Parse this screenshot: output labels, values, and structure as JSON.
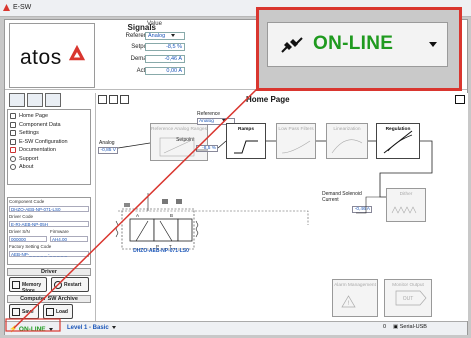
{
  "window": {
    "title": "E-SW"
  },
  "logo": {
    "text": "atos"
  },
  "signals": {
    "title": "Signals",
    "value_header": "Value",
    "rows": [
      {
        "label": "Reference",
        "value": "Analog"
      },
      {
        "label": "Setpoint",
        "value": "-8,5 %"
      },
      {
        "label": "Demand",
        "value": "-0,46 A"
      },
      {
        "label": "Actual",
        "value": "0,00 A"
      }
    ]
  },
  "callout": {
    "label": "ON-LINE",
    "icon": "plug-icon"
  },
  "leftnav": {
    "menu": [
      "Home Page",
      "Component Data",
      "Settings",
      "E-SW Configuration",
      "Documentation",
      "Support",
      "About"
    ]
  },
  "component_info": {
    "component_code_label": "Component Code",
    "component_code": "DHZO-AEB-NP-071-LS0",
    "driver_code_label": "Driver Code",
    "driver_code": "E-RI-AEB-NP-05H",
    "driver_sn_label": "Driver S/N",
    "driver_sn": "000000",
    "firmware_label": "Firmware",
    "firmware": "AH4.00",
    "factory_code_label": "Factory Setting Code",
    "factory_code": "AEB-NP-_ _ _ _ _ -_ _ _ _ _"
  },
  "driver": {
    "title": "Driver",
    "memory_store": "Memory Store",
    "restart": "Restart"
  },
  "archive": {
    "title": "Computer SW Archive",
    "save": "Save",
    "load": "Load"
  },
  "main": {
    "page_title": "Home Page",
    "analog_label": "Analog",
    "analog_value": "-0,85 V",
    "reference_label": "Reference",
    "reference_value": "Analog",
    "setpoint_label": "Setpoint",
    "setpoint_value": "-8,5 %",
    "blocks": [
      {
        "name": "Reference Analog Ranges",
        "active": false
      },
      {
        "name": "Ramps",
        "active": true
      },
      {
        "name": "Low Pass Filters",
        "active": false
      },
      {
        "name": "Linearization",
        "active": false
      },
      {
        "name": "Regulation",
        "active": true
      },
      {
        "name": "Dither",
        "active": false
      },
      {
        "name": "Alarm Management",
        "active": false
      },
      {
        "name": "Monitor Output",
        "active": false
      }
    ],
    "demand_label": "Demand Solenoid Current",
    "demand_value": "-0,46 A",
    "valve_name": "DHZO-AEB-NP-071-LS0",
    "port_p": "P",
    "port_t": "T",
    "port_a": "A",
    "port_b": "B",
    "out_label": "OUT"
  },
  "statusbar": {
    "online": "ON-LINE",
    "level": "Level 1 - Basic",
    "zero": "0",
    "serial": "Serial-USB"
  },
  "colors": {
    "accent_green": "#1f9a1f",
    "highlight_red": "#d9362f",
    "value_blue": "#1a55b8"
  }
}
